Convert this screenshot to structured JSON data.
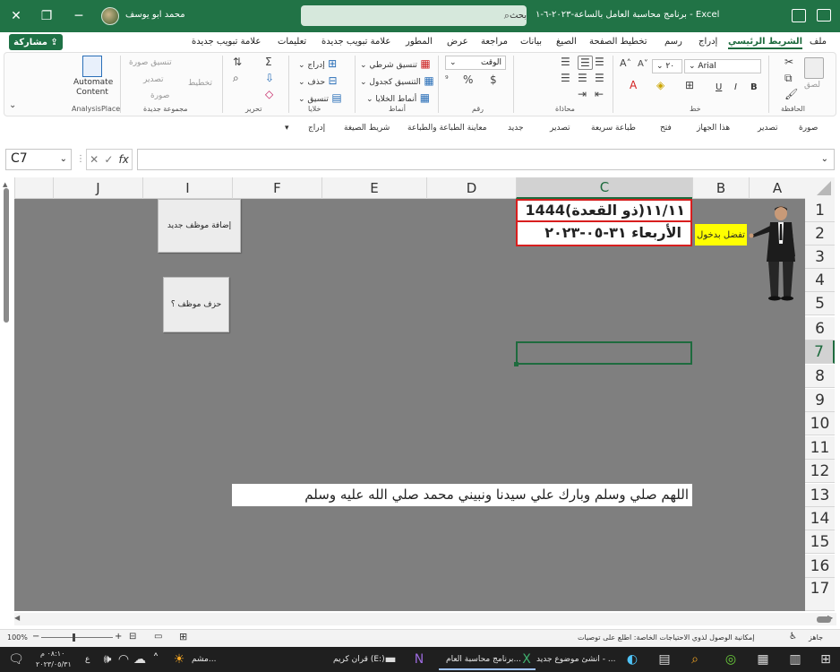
{
  "titlebar": {
    "app_title": "برنامج محاسبة العامل بالساعة-٢٠٢٣-٦-١ - Excel",
    "search_placeholder": "بحث",
    "user_name": "محمد ابو يوسف",
    "close": "✕",
    "restore": "❐",
    "minimize": "─"
  },
  "menu": {
    "tabs": [
      "ملف",
      "الشريط الرئيسي",
      "إدراج",
      "رسم",
      "تخطيط الصفحة",
      "الصيغ",
      "بيانات",
      "مراجعة",
      "عرض",
      "المطور",
      "علامة تبويب جديدة",
      "تعليمات",
      "علامة تبويب جديدة"
    ],
    "active_tab": "الشريط الرئيسي",
    "share": "مشاركة"
  },
  "ribbon": {
    "clipboard": {
      "paste": "لصق",
      "group": "الحافظة"
    },
    "font": {
      "name": "Arial",
      "size": "٢٠",
      "bold": "B",
      "italic": "I",
      "underline": "U",
      "group": "خط"
    },
    "alignment": {
      "group": "محاذاة"
    },
    "number": {
      "format": "الوقت",
      "percent": "%",
      "group": "رقم"
    },
    "styles": {
      "conditional": "تنسيق شرطي",
      "as_table": "التنسيق كجدول",
      "cell_styles": "أنماط الخلايا",
      "group": "أنماط"
    },
    "cells": {
      "insert": "إدراج",
      "delete": "حذف",
      "format": "تنسيق",
      "group": "خلايا"
    },
    "editing": {
      "group": "تحرير"
    },
    "new_group": {
      "format_image": "تنسيق صورة",
      "export": "تصدير",
      "layout": "تخطيط",
      "image": "صورة",
      "group": "مجموعة جديدة"
    },
    "analysisplace": {
      "automate_content": "Automate Content",
      "group": "AnalysisPlace"
    }
  },
  "qat": {
    "items": [
      "صورة",
      "تصدير",
      "هذا الجهاز",
      "فتح",
      "طباعة سريعة",
      "تصدير",
      "جديد",
      "معاينة الطباعة والطباعة",
      "شريط الصيغة",
      "إدراج"
    ]
  },
  "formula_bar": {
    "name_box": "C7",
    "formula": "",
    "fx": "fx"
  },
  "grid": {
    "columns": [
      "A",
      "B",
      "C",
      "D",
      "E",
      "F",
      "I",
      "J"
    ],
    "selected_column": "C",
    "rows": [
      "1",
      "2",
      "3",
      "4",
      "5",
      "6",
      "7",
      "8",
      "9",
      "10",
      "11",
      "12",
      "13",
      "14",
      "15",
      "16",
      "17"
    ],
    "selected_row": "7",
    "cells": {
      "c1": "١١/١١(ذو القعدة)1444",
      "c2": "الأربعاء ٣١-٠٥-٢٠٢٣",
      "b2": "تفضل بدخول",
      "a13": "اللهم صلي وسلم وبارك علي سيدنا ونبيني محمد صلي الله عليه وسلم"
    },
    "buttons": {
      "add_employee": "إضافة موظف جديد",
      "delete_employee": "حزف موظف ؟"
    }
  },
  "statusbar": {
    "ready": "جاهز",
    "accessibility": "إمكانية الوصول لذوي الاحتياجات الخاصة: اطلع على توصيات",
    "zoom": "100%"
  },
  "taskbar": {
    "clock_time": "٠٨:١٠ م",
    "clock_date": "٢٠٢٣/٠٥/٣١",
    "lang": "ع",
    "items": [
      "مشم...",
      "قران كريم (E:)",
      "برنامج محاسبة العام...",
      "انشئ موضوع جديد - ..."
    ]
  },
  "colors": {
    "excel_green": "#217346",
    "grid_bg": "#7f7f7f",
    "date_border": "#d81e1e",
    "login_yellow": "#ffff00"
  }
}
